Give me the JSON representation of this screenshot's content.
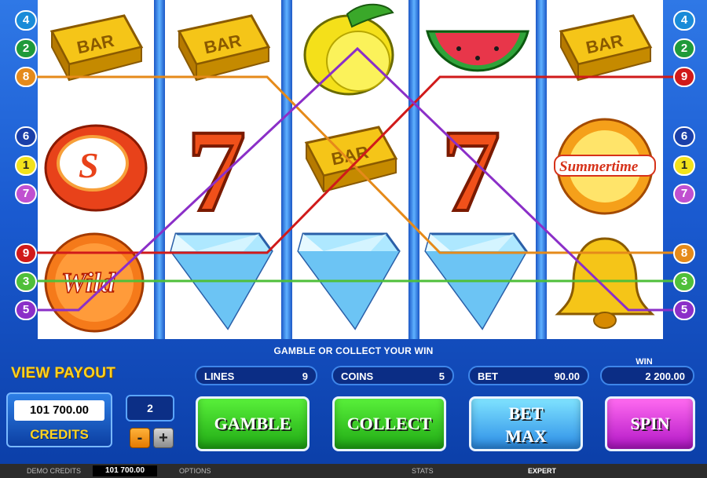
{
  "game": {
    "message": "GAMBLE OR COLLECT YOUR WIN",
    "reels": [
      [
        "bar-symbol",
        "orange-s-chip-symbol",
        "wild-symbol"
      ],
      [
        "bar-symbol",
        "seven-symbol",
        "diamond-symbol"
      ],
      [
        "lemon-symbol",
        "bar-symbol",
        "diamond-symbol"
      ],
      [
        "watermelon-symbol",
        "seven-symbol",
        "diamond-symbol"
      ],
      [
        "bar-symbol",
        "summertime-symbol",
        "bell-symbol"
      ]
    ],
    "symbol_text": {
      "bar": "BAR",
      "wild": "Wild",
      "summertime": "Summertime",
      "seven": "7"
    },
    "left_line_numbers": [
      "4",
      "2",
      "8",
      "6",
      "1",
      "7",
      "9",
      "3",
      "5"
    ],
    "right_line_numbers": [
      "4",
      "2",
      "9",
      "6",
      "1",
      "7",
      "8",
      "3",
      "5"
    ],
    "line_colors": {
      "1": "#f2e21c",
      "2": "#1f9a3a",
      "3": "#4fbf3a",
      "4": "#1a8bd8",
      "5": "#8b2fc8",
      "6": "#1a3fa8",
      "7": "#c050d0",
      "8": "#e58a1a",
      "9": "#d01a1a"
    }
  },
  "controls": {
    "view_payout": "VIEW PAYOUT",
    "credits_value": "101 700.00",
    "credits_label": "CREDITS",
    "coin_value": "2",
    "minus": "-",
    "plus": "+",
    "lines_label": "LINES",
    "lines_value": "9",
    "coins_label": "COINS",
    "coins_value": "5",
    "bet_label": "BET",
    "bet_value": "90.00",
    "win_label": "WIN",
    "win_value": "2 200.00",
    "gamble": "GAMBLE",
    "collect": "COLLECT",
    "bet_max_1": "BET",
    "bet_max_2": "MAX",
    "spin": "SPIN"
  },
  "statusbar": {
    "demo_credits": "DEMO CREDITS",
    "demo_value": "101 700.00",
    "options": "OPTIONS",
    "stats": "STATS",
    "expert": "EXPERT"
  }
}
